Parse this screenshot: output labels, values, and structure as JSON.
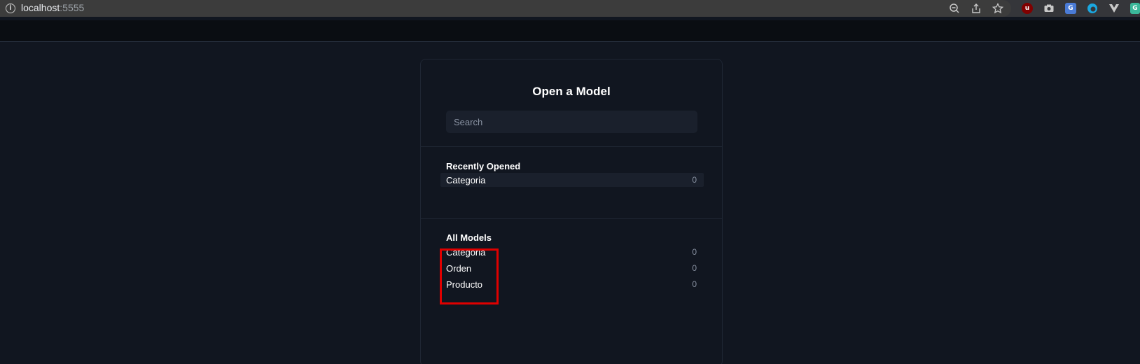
{
  "browser": {
    "url_host": "localhost",
    "url_port": ":5555"
  },
  "panel": {
    "title": "Open a Model",
    "search_placeholder": "Search",
    "recent": {
      "title": "Recently Opened",
      "items": [
        {
          "label": "Categoria",
          "count": "0"
        }
      ]
    },
    "all": {
      "title": "All Models",
      "items": [
        {
          "label": "Categoria",
          "count": "0"
        },
        {
          "label": "Orden",
          "count": "0"
        },
        {
          "label": "Producto",
          "count": "0"
        }
      ]
    }
  },
  "colors": {
    "background": "#111620",
    "header": "#0a0d12",
    "row_highlight": "#1a202c",
    "annotation": "#e00000"
  }
}
